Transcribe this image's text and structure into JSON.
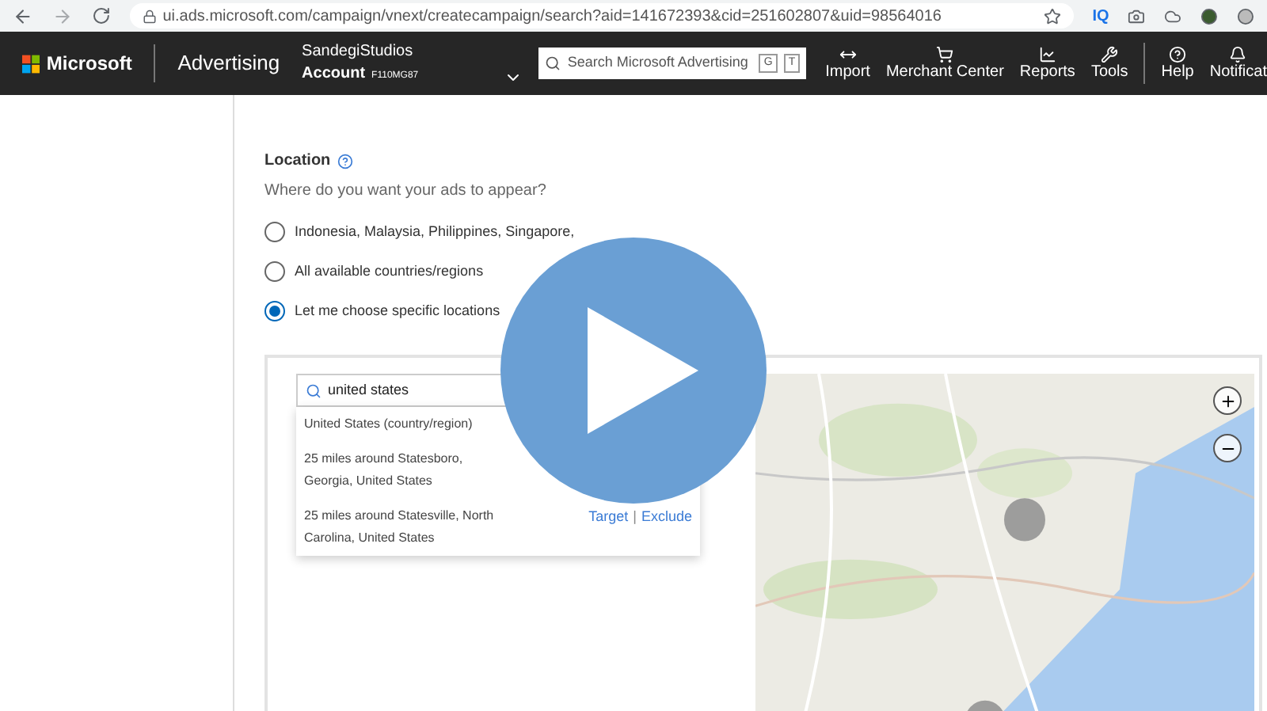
{
  "browser": {
    "url": "ui.ads.microsoft.com/campaign/vnext/createcampaign/search?aid=141672393&cid=251602807&uid=98564016",
    "extension_badge": "IQ"
  },
  "nav": {
    "brand": "Microsoft",
    "product": "Advertising",
    "account_name": "SandegiStudios",
    "account_label": "Account",
    "account_id": "F110MG87",
    "search": {
      "placeholder": "Search Microsoft Advertising",
      "keys": [
        "G",
        "T"
      ]
    },
    "items": [
      {
        "label": "Import",
        "kind": "import"
      },
      {
        "label": "Merchant Center",
        "kind": "cart"
      },
      {
        "label": "Reports",
        "kind": "chart"
      },
      {
        "label": "Tools",
        "kind": "wrench"
      },
      {
        "label": "Help",
        "kind": "help"
      },
      {
        "label": "Notificat",
        "kind": "bell"
      }
    ]
  },
  "location": {
    "title": "Location",
    "question": "Where do you want your ads to appear?",
    "options": [
      {
        "label": "Indonesia, Malaysia, Philippines, Singapore,",
        "selected": false
      },
      {
        "label": "All available countries/regions",
        "selected": false
      },
      {
        "label": "Let me choose specific locations",
        "selected": true
      }
    ],
    "search": {
      "value": "united states"
    },
    "results": [
      {
        "name": "United States (country/region)"
      },
      {
        "name": "25 miles around Statesboro, Georgia, United States"
      },
      {
        "name": "25 miles around Statesville, North Carolina, United States",
        "target": "Target",
        "separator": "|",
        "exclude": "Exclude"
      }
    ]
  }
}
